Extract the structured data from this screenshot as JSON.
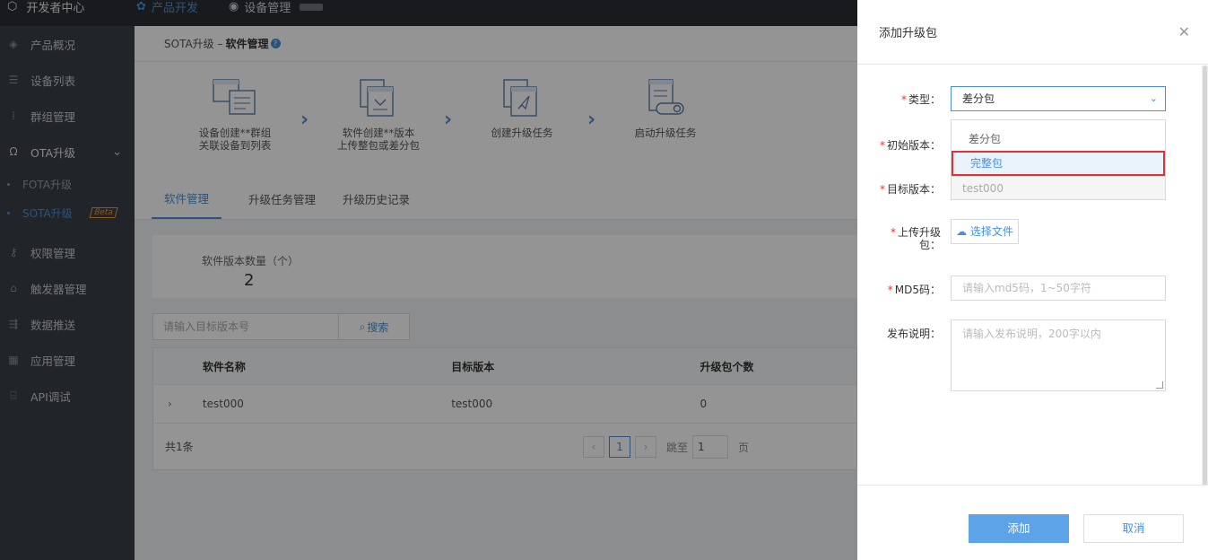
{
  "topbar": {
    "brand": "开发者中心",
    "tabs": [
      {
        "label": "产品开发",
        "icon": "product-icon"
      },
      {
        "label": "设备管理",
        "icon": "device-icon"
      }
    ]
  },
  "sidebar": {
    "items": [
      {
        "label": "产品概况",
        "icon": "cube-icon"
      },
      {
        "label": "设备列表",
        "icon": "list-icon"
      },
      {
        "label": "群组管理",
        "icon": "grid-icon"
      },
      {
        "label": "OTA升级",
        "icon": "ota-icon"
      },
      {
        "label": "FOTA升级"
      },
      {
        "label": "SOTA升级",
        "badge": "Beta"
      },
      {
        "label": "权限管理",
        "icon": "key-icon"
      },
      {
        "label": "触发器管理",
        "icon": "trigger-icon"
      },
      {
        "label": "数据推送",
        "icon": "push-icon"
      },
      {
        "label": "应用管理",
        "icon": "apps-icon"
      },
      {
        "label": "API调试",
        "icon": "api-icon"
      }
    ]
  },
  "breadcrumb": {
    "parent": "SOTA升级 –",
    "current": "软件管理"
  },
  "steps": [
    {
      "line1": "设备创建**群组",
      "line2": "关联设备到列表"
    },
    {
      "line1": "软件创建**版本",
      "line2": "上传整包或差分包"
    },
    {
      "line1": "创建升级任务",
      "line2": ""
    },
    {
      "line1": "启动升级任务",
      "line2": ""
    }
  ],
  "tabs": [
    "软件管理",
    "升级任务管理",
    "升级历史记录"
  ],
  "stat": {
    "label": "软件版本数量（个）",
    "value": "2"
  },
  "search": {
    "placeholder": "请输入目标版本号",
    "button": "搜索"
  },
  "table": {
    "headers": [
      "软件名称",
      "目标版本",
      "升级包个数"
    ],
    "rows": [
      {
        "name": "test000",
        "version": "test000",
        "count": "0"
      }
    ],
    "total": "共1条"
  },
  "pager": {
    "current": "1",
    "jump_label": "跳至",
    "jump_value": "1",
    "page_unit": "页"
  },
  "drawer": {
    "title": "添加升级包",
    "type_label": "类型：",
    "type_value": "差分包",
    "type_options": [
      "差分包",
      "完整包"
    ],
    "initial_label": "初始版本：",
    "target_label": "目标版本：",
    "target_value": "test000",
    "upload_label_1": "上传升级",
    "upload_label_2": "包：",
    "upload_button": "选择文件",
    "md5_label": "MD5码：",
    "md5_placeholder": "请输入md5码，1~50字符",
    "desc_label": "发布说明：",
    "desc_placeholder": "请输入发布说明，200字以内",
    "add_button": "添加",
    "cancel_button": "取消"
  },
  "colors": {
    "accent": "#4a90d9",
    "required": "#e33333",
    "highlight_border": "#d9343a"
  }
}
